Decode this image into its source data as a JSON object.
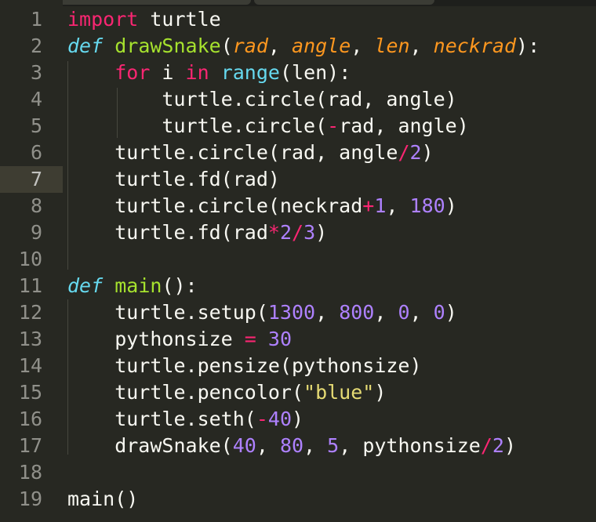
{
  "editor": {
    "theme_colors": {
      "background": "#272822",
      "keyword": "#f92672",
      "storage": "#66d9ef",
      "function": "#a6e22e",
      "parameter": "#fd971f",
      "number": "#ae81ff",
      "string": "#e6db74",
      "text": "#f8f8f2",
      "line_number": "#90908a"
    },
    "active_line": 7,
    "lines": [
      {
        "n": "1",
        "tokens": [
          {
            "t": "import",
            "c": "kw"
          },
          {
            "t": " turtle",
            "c": "plain"
          }
        ]
      },
      {
        "n": "2",
        "tokens": [
          {
            "t": "def",
            "c": "def"
          },
          {
            "t": " ",
            "c": "plain"
          },
          {
            "t": "drawSnake",
            "c": "fn"
          },
          {
            "t": "(",
            "c": "plain"
          },
          {
            "t": "rad",
            "c": "param"
          },
          {
            "t": ", ",
            "c": "plain"
          },
          {
            "t": "angle",
            "c": "param"
          },
          {
            "t": ", ",
            "c": "plain"
          },
          {
            "t": "len",
            "c": "param"
          },
          {
            "t": ", ",
            "c": "plain"
          },
          {
            "t": "neckrad",
            "c": "param"
          },
          {
            "t": "):",
            "c": "plain"
          }
        ]
      },
      {
        "n": "3",
        "tokens": [
          {
            "t": "    ",
            "c": "plain"
          },
          {
            "t": "for",
            "c": "kw"
          },
          {
            "t": " i ",
            "c": "plain"
          },
          {
            "t": "in",
            "c": "kw"
          },
          {
            "t": " ",
            "c": "plain"
          },
          {
            "t": "range",
            "c": "builtin"
          },
          {
            "t": "(len):",
            "c": "plain"
          }
        ]
      },
      {
        "n": "4",
        "tokens": [
          {
            "t": "        turtle.circle(rad, angle)",
            "c": "plain"
          }
        ]
      },
      {
        "n": "5",
        "tokens": [
          {
            "t": "        turtle.circle(",
            "c": "plain"
          },
          {
            "t": "-",
            "c": "op"
          },
          {
            "t": "rad, angle)",
            "c": "plain"
          }
        ]
      },
      {
        "n": "6",
        "tokens": [
          {
            "t": "    turtle.circle(rad, angle",
            "c": "plain"
          },
          {
            "t": "/",
            "c": "op"
          },
          {
            "t": "2",
            "c": "num"
          },
          {
            "t": ")",
            "c": "plain"
          }
        ]
      },
      {
        "n": "7",
        "tokens": [
          {
            "t": "    turtle.fd(rad)",
            "c": "plain"
          }
        ]
      },
      {
        "n": "8",
        "tokens": [
          {
            "t": "    turtle.circle(neckrad",
            "c": "plain"
          },
          {
            "t": "+",
            "c": "op"
          },
          {
            "t": "1",
            "c": "num"
          },
          {
            "t": ", ",
            "c": "plain"
          },
          {
            "t": "180",
            "c": "num"
          },
          {
            "t": ")",
            "c": "plain"
          }
        ]
      },
      {
        "n": "9",
        "tokens": [
          {
            "t": "    turtle.fd(rad",
            "c": "plain"
          },
          {
            "t": "*",
            "c": "op"
          },
          {
            "t": "2",
            "c": "num"
          },
          {
            "t": "/",
            "c": "op"
          },
          {
            "t": "3",
            "c": "num"
          },
          {
            "t": ")",
            "c": "plain"
          }
        ]
      },
      {
        "n": "10",
        "tokens": []
      },
      {
        "n": "11",
        "tokens": [
          {
            "t": "def",
            "c": "def"
          },
          {
            "t": " ",
            "c": "plain"
          },
          {
            "t": "main",
            "c": "fn"
          },
          {
            "t": "():",
            "c": "plain"
          }
        ]
      },
      {
        "n": "12",
        "tokens": [
          {
            "t": "    turtle.setup(",
            "c": "plain"
          },
          {
            "t": "1300",
            "c": "num"
          },
          {
            "t": ", ",
            "c": "plain"
          },
          {
            "t": "800",
            "c": "num"
          },
          {
            "t": ", ",
            "c": "plain"
          },
          {
            "t": "0",
            "c": "num"
          },
          {
            "t": ", ",
            "c": "plain"
          },
          {
            "t": "0",
            "c": "num"
          },
          {
            "t": ")",
            "c": "plain"
          }
        ]
      },
      {
        "n": "13",
        "tokens": [
          {
            "t": "    pythonsize ",
            "c": "plain"
          },
          {
            "t": "=",
            "c": "op"
          },
          {
            "t": " ",
            "c": "plain"
          },
          {
            "t": "30",
            "c": "num"
          }
        ]
      },
      {
        "n": "14",
        "tokens": [
          {
            "t": "    turtle.pensize(pythonsize)",
            "c": "plain"
          }
        ]
      },
      {
        "n": "15",
        "tokens": [
          {
            "t": "    turtle.pencolor(",
            "c": "plain"
          },
          {
            "t": "\"blue\"",
            "c": "str"
          },
          {
            "t": ")",
            "c": "plain"
          }
        ]
      },
      {
        "n": "16",
        "tokens": [
          {
            "t": "    turtle.seth(",
            "c": "plain"
          },
          {
            "t": "-",
            "c": "op"
          },
          {
            "t": "40",
            "c": "num"
          },
          {
            "t": ")",
            "c": "plain"
          }
        ]
      },
      {
        "n": "17",
        "tokens": [
          {
            "t": "    drawSnake(",
            "c": "plain"
          },
          {
            "t": "40",
            "c": "num"
          },
          {
            "t": ", ",
            "c": "plain"
          },
          {
            "t": "80",
            "c": "num"
          },
          {
            "t": ", ",
            "c": "plain"
          },
          {
            "t": "5",
            "c": "num"
          },
          {
            "t": ", pythonsize",
            "c": "plain"
          },
          {
            "t": "/",
            "c": "op"
          },
          {
            "t": "2",
            "c": "num"
          },
          {
            "t": ")",
            "c": "plain"
          }
        ]
      },
      {
        "n": "18",
        "tokens": []
      },
      {
        "n": "19",
        "tokens": [
          {
            "t": "main()",
            "c": "plain"
          }
        ]
      }
    ]
  }
}
